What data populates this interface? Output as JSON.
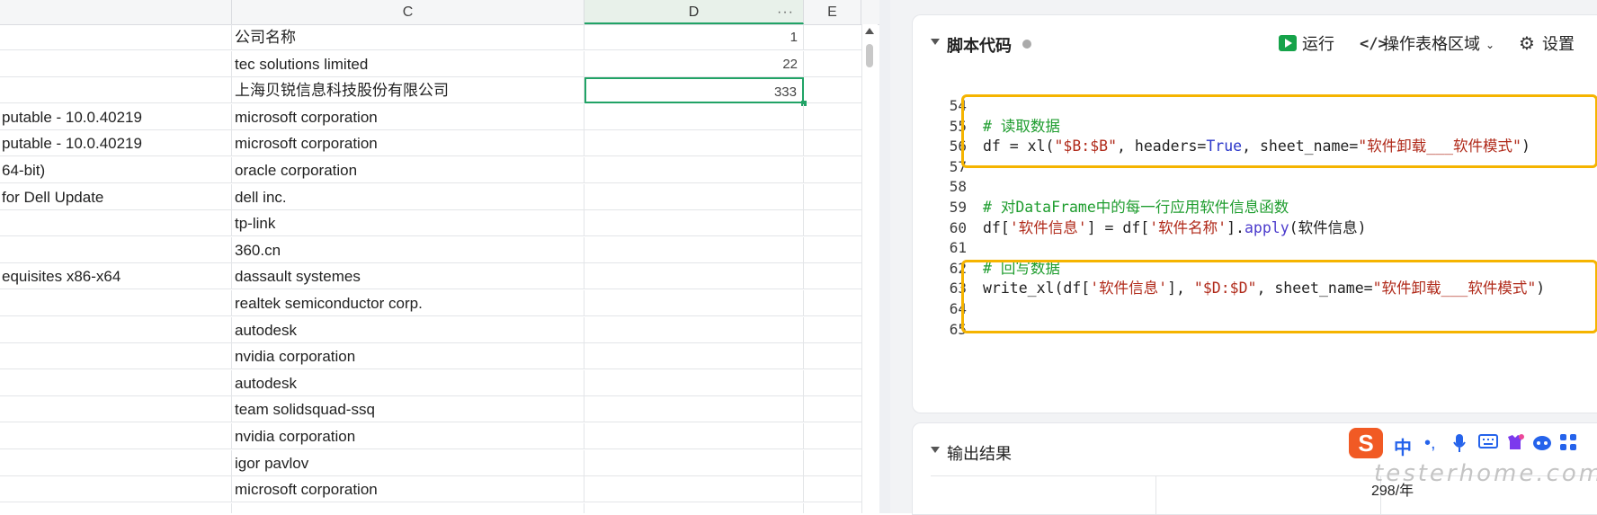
{
  "sheet": {
    "columns": [
      "C",
      "D",
      "E"
    ],
    "column_d_more": "···",
    "rows": [
      {
        "b": "",
        "c": "公司名称",
        "d": "1"
      },
      {
        "b": "",
        "c": "tec solutions limited",
        "d": "22"
      },
      {
        "b": "",
        "c": "上海贝锐信息科技股份有限公司",
        "d": "333"
      },
      {
        "b": "putable - 10.0.40219",
        "c": "microsoft corporation",
        "d": ""
      },
      {
        "b": "putable - 10.0.40219",
        "c": "microsoft corporation",
        "d": ""
      },
      {
        "b": "64-bit)",
        "c": "oracle corporation",
        "d": ""
      },
      {
        "b": "for Dell Update",
        "c": "dell inc.",
        "d": ""
      },
      {
        "b": "",
        "c": "tp-link",
        "d": ""
      },
      {
        "b": "",
        "c": "360.cn",
        "d": ""
      },
      {
        "b": "equisites x86-x64",
        "c": "dassault systemes",
        "d": ""
      },
      {
        "b": "",
        "c": "realtek semiconductor corp.",
        "d": ""
      },
      {
        "b": "",
        "c": "autodesk",
        "d": ""
      },
      {
        "b": "",
        "c": "nvidia corporation",
        "d": ""
      },
      {
        "b": "",
        "c": "autodesk",
        "d": ""
      },
      {
        "b": "",
        "c": "team solidsquad-ssq",
        "d": ""
      },
      {
        "b": "",
        "c": "nvidia corporation",
        "d": ""
      },
      {
        "b": "",
        "c": "igor pavlov",
        "d": ""
      },
      {
        "b": "",
        "c": "microsoft corporation",
        "d": ""
      },
      {
        "b": "",
        "c": "",
        "d": ""
      }
    ],
    "active_cell_row": 2
  },
  "script": {
    "title": "脚本代码",
    "run_label": "运行",
    "range_label": "操作表格区域",
    "settings_label": "设置",
    "run_icon": "play-icon",
    "range_icon": "code-brackets-icon",
    "settings_icon": "gear-icon",
    "lines": [
      {
        "num": "54",
        "tokens": []
      },
      {
        "num": "55",
        "tokens": [
          {
            "t": "# 读取数据",
            "k": "cmt"
          }
        ]
      },
      {
        "num": "56",
        "tokens": [
          {
            "t": "df = xl(",
            "k": ""
          },
          {
            "t": "\"$B:$B\"",
            "k": "str"
          },
          {
            "t": ", headers=",
            "k": ""
          },
          {
            "t": "True",
            "k": "kw"
          },
          {
            "t": ", sheet_name=",
            "k": ""
          },
          {
            "t": "\"软件卸载___软件模式\"",
            "k": "str"
          },
          {
            "t": ")",
            "k": ""
          }
        ]
      },
      {
        "num": "57",
        "tokens": []
      },
      {
        "num": "58",
        "tokens": []
      },
      {
        "num": "59",
        "tokens": [
          {
            "t": "# 对DataFrame中的每一行应用软件信息函数",
            "k": "cmt"
          }
        ]
      },
      {
        "num": "60",
        "tokens": [
          {
            "t": "df[",
            "k": ""
          },
          {
            "t": "'软件信息'",
            "k": "str"
          },
          {
            "t": "] = df[",
            "k": ""
          },
          {
            "t": "'软件名称'",
            "k": "str"
          },
          {
            "t": "].",
            "k": ""
          },
          {
            "t": "apply",
            "k": "fn"
          },
          {
            "t": "(软件信息)",
            "k": ""
          }
        ]
      },
      {
        "num": "61",
        "tokens": []
      },
      {
        "num": "62",
        "tokens": [
          {
            "t": "# 回写数据",
            "k": "cmt"
          }
        ]
      },
      {
        "num": "63",
        "tokens": [
          {
            "t": "write_xl(df[",
            "k": ""
          },
          {
            "t": "'软件信息'",
            "k": "str"
          },
          {
            "t": "], ",
            "k": ""
          },
          {
            "t": "\"$D:$D\"",
            "k": "str"
          },
          {
            "t": ", sheet_name=",
            "k": ""
          },
          {
            "t": "\"软件卸载___软件模式\"",
            "k": "str"
          },
          {
            "t": ")",
            "k": ""
          }
        ]
      },
      {
        "num": "64",
        "tokens": []
      },
      {
        "num": "65",
        "tokens": []
      }
    ],
    "highlight_color": "#f5b400"
  },
  "output": {
    "title": "输出结果",
    "price_text": "298/年"
  },
  "ime": {
    "logo": "S",
    "mode": "中",
    "punct": "•,",
    "icons": [
      "microphone-icon",
      "keyboard-icon",
      "skin-icon",
      "robot-icon",
      "grid-icon"
    ]
  },
  "watermark": "testerhome.com"
}
